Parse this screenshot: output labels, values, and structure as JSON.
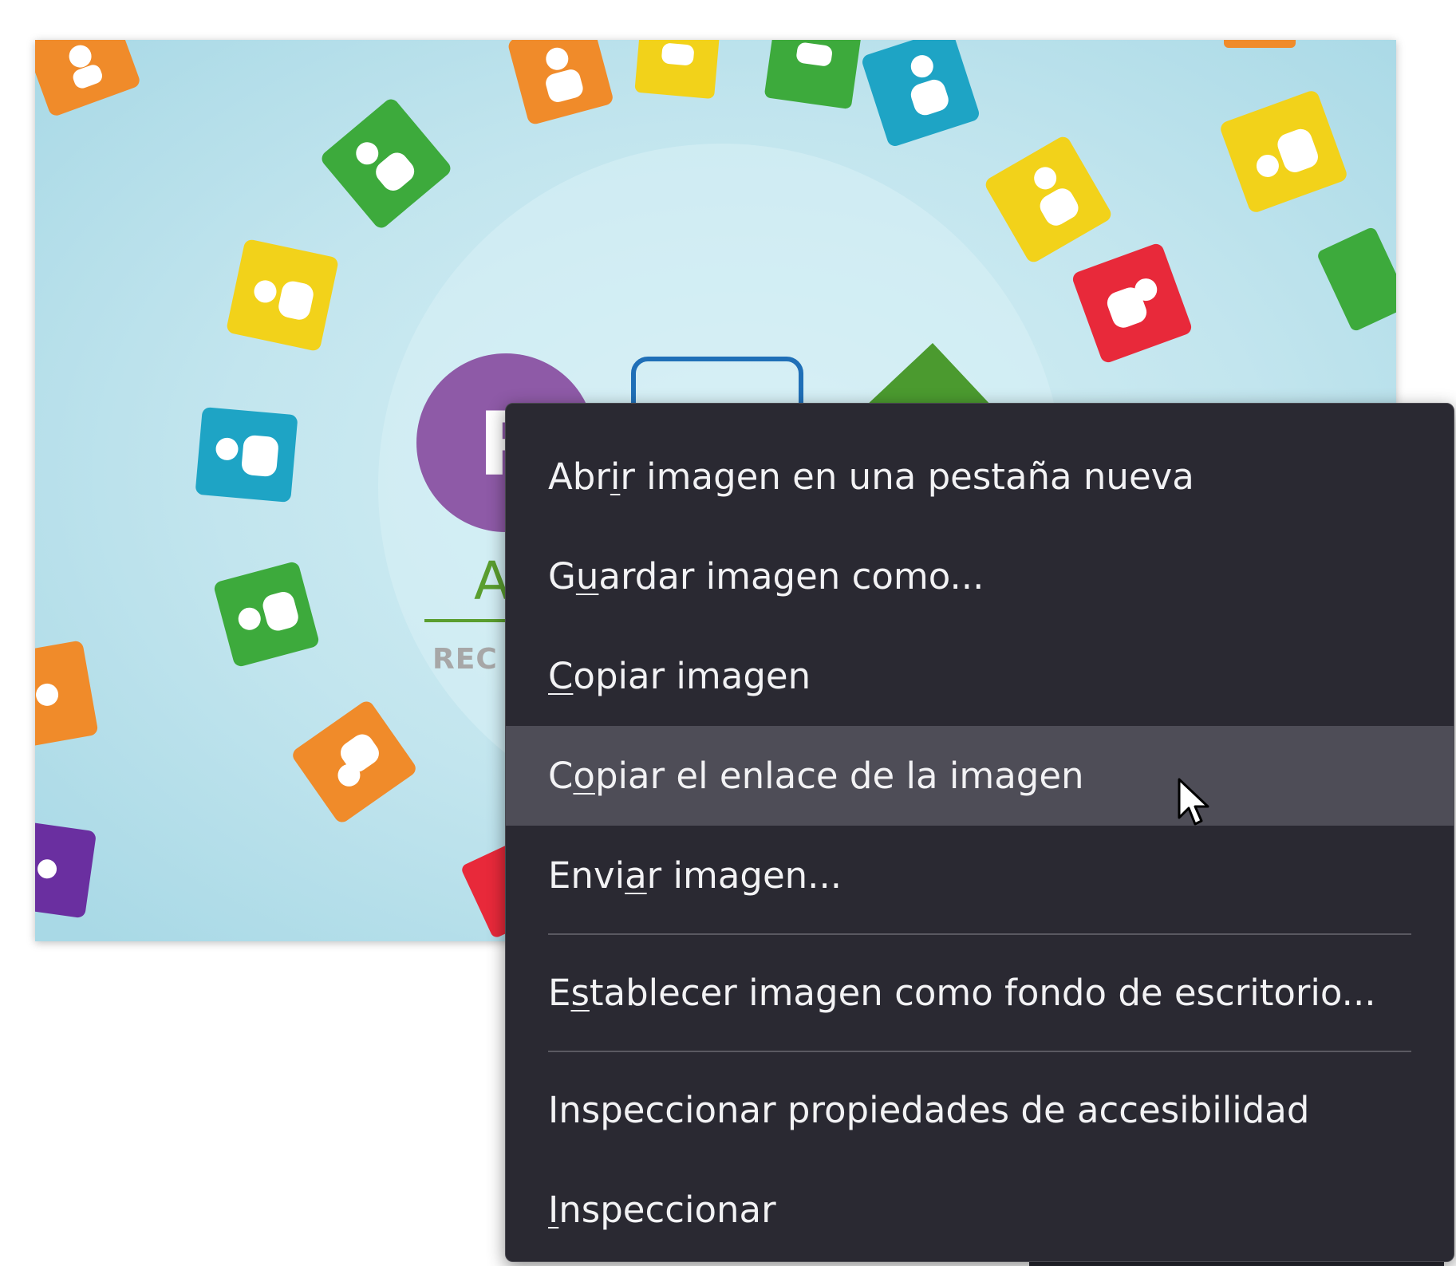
{
  "background_image": {
    "avatar_letter": "R",
    "brand_letter": "A",
    "brand_subtext": "REC"
  },
  "context_menu": {
    "items": [
      {
        "pre": "Abr",
        "accel": "i",
        "post": "r imagen en una pestaña nueva"
      },
      {
        "pre": "G",
        "accel": "u",
        "post": "ardar imagen como..."
      },
      {
        "pre": "",
        "accel": "C",
        "post": "opiar imagen"
      },
      {
        "pre": "C",
        "accel": "o",
        "post": "piar el enlace de la imagen"
      },
      {
        "pre": "Envi",
        "accel": "a",
        "post": "r imagen..."
      },
      {
        "pre": "E",
        "accel": "s",
        "post": "tablecer imagen como fondo de escritorio..."
      },
      {
        "pre": "Inspeccionar propiedades de accesibilidad",
        "accel": "",
        "post": ""
      },
      {
        "pre": "",
        "accel": "I",
        "post": "nspeccionar"
      }
    ],
    "hovered_item": "Copiar el enlace de la imagen"
  },
  "colors": {
    "menu_background": "#2a2932",
    "menu_hover": "#4e4d57",
    "menu_text": "#f2f2f4",
    "page_background": "#ffffff",
    "image_background": "#bfe3ec"
  },
  "icons": {
    "cursor": "mouse-pointer-icon"
  }
}
